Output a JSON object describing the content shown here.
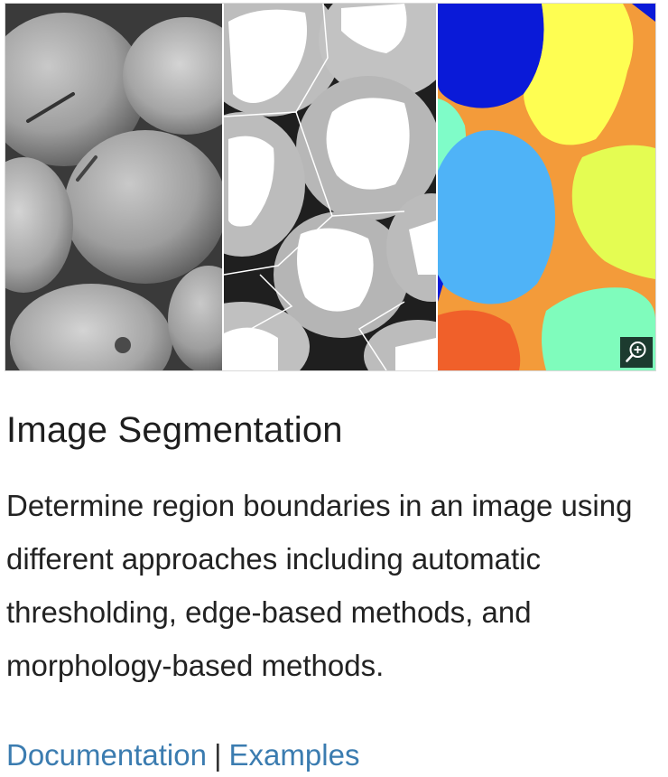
{
  "figure": {
    "panels": [
      {
        "name": "grayscale-photo"
      },
      {
        "name": "thresholded-image"
      },
      {
        "name": "labeled-regions"
      }
    ],
    "zoom_icon": "zoom-in-icon"
  },
  "title": "Image Segmentation",
  "description": "Determine region boundaries in an image using different approaches including automatic thresholding, edge-based methods, and morphology-based methods.",
  "links": {
    "documentation": "Documentation",
    "separator": "|",
    "examples": "Examples"
  },
  "colors": {
    "link": "#3b7cb0",
    "title": "#1e1e1e",
    "zoom_bg": "#1c3b2f"
  }
}
